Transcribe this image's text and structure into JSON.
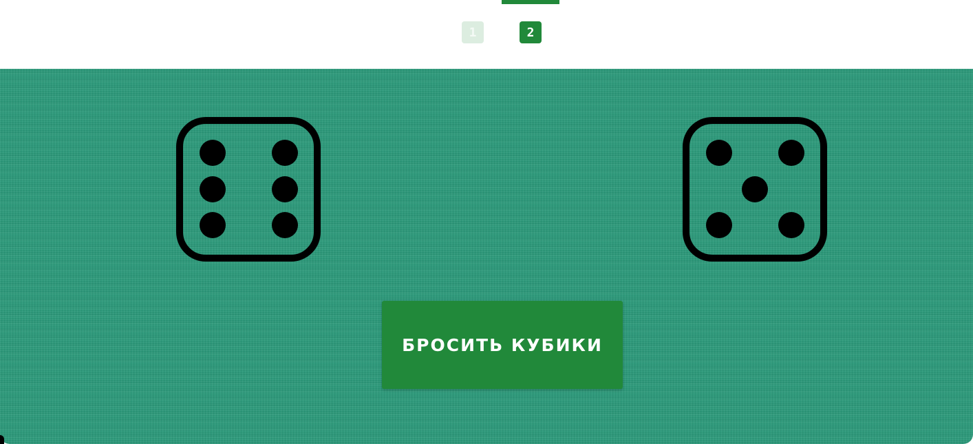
{
  "players": {
    "tabs": [
      {
        "label": "1",
        "active": false
      },
      {
        "label": "2",
        "active": true
      }
    ],
    "active_color": "#21893a",
    "inactive_color": "#dcede0"
  },
  "table": {
    "background_color": "#2a9a7a"
  },
  "dice": [
    {
      "value": 6
    },
    {
      "value": 5
    }
  ],
  "roll_button": {
    "label": "БРОСИТЬ КУБИКИ",
    "color": "#21893a"
  }
}
